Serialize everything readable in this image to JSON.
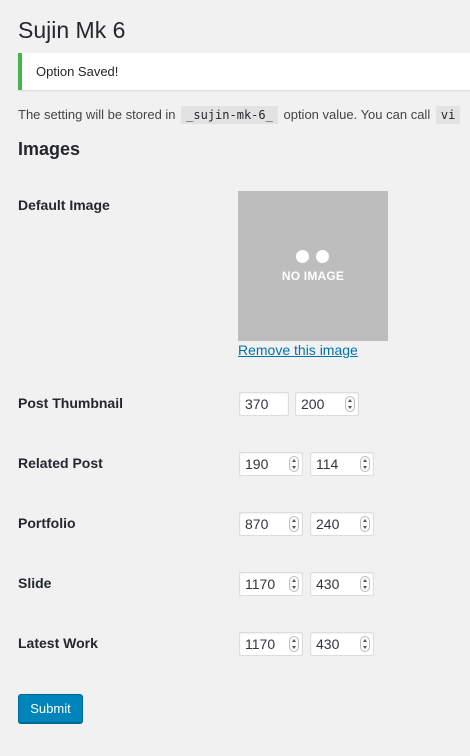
{
  "page": {
    "title": "Sujin Mk 6",
    "notice": "Option Saved!",
    "description": {
      "before": "The setting will be stored in",
      "code1": "_sujin-mk-6_",
      "after": "option value. You can call",
      "code2": "vi"
    },
    "section_title": "Images"
  },
  "default_image": {
    "label": "Default Image",
    "placeholder_text": "NO IMAGE",
    "remove_link": "Remove this image"
  },
  "sizes": [
    {
      "label": "Post Thumbnail",
      "width": "370",
      "height": "200"
    },
    {
      "label": "Related Post",
      "width": "190",
      "height": "114"
    },
    {
      "label": "Portfolio",
      "width": "870",
      "height": "240"
    },
    {
      "label": "Slide",
      "width": "1170",
      "height": "430"
    },
    {
      "label": "Latest Work",
      "width": "1170",
      "height": "430"
    }
  ],
  "submit_label": "Submit"
}
